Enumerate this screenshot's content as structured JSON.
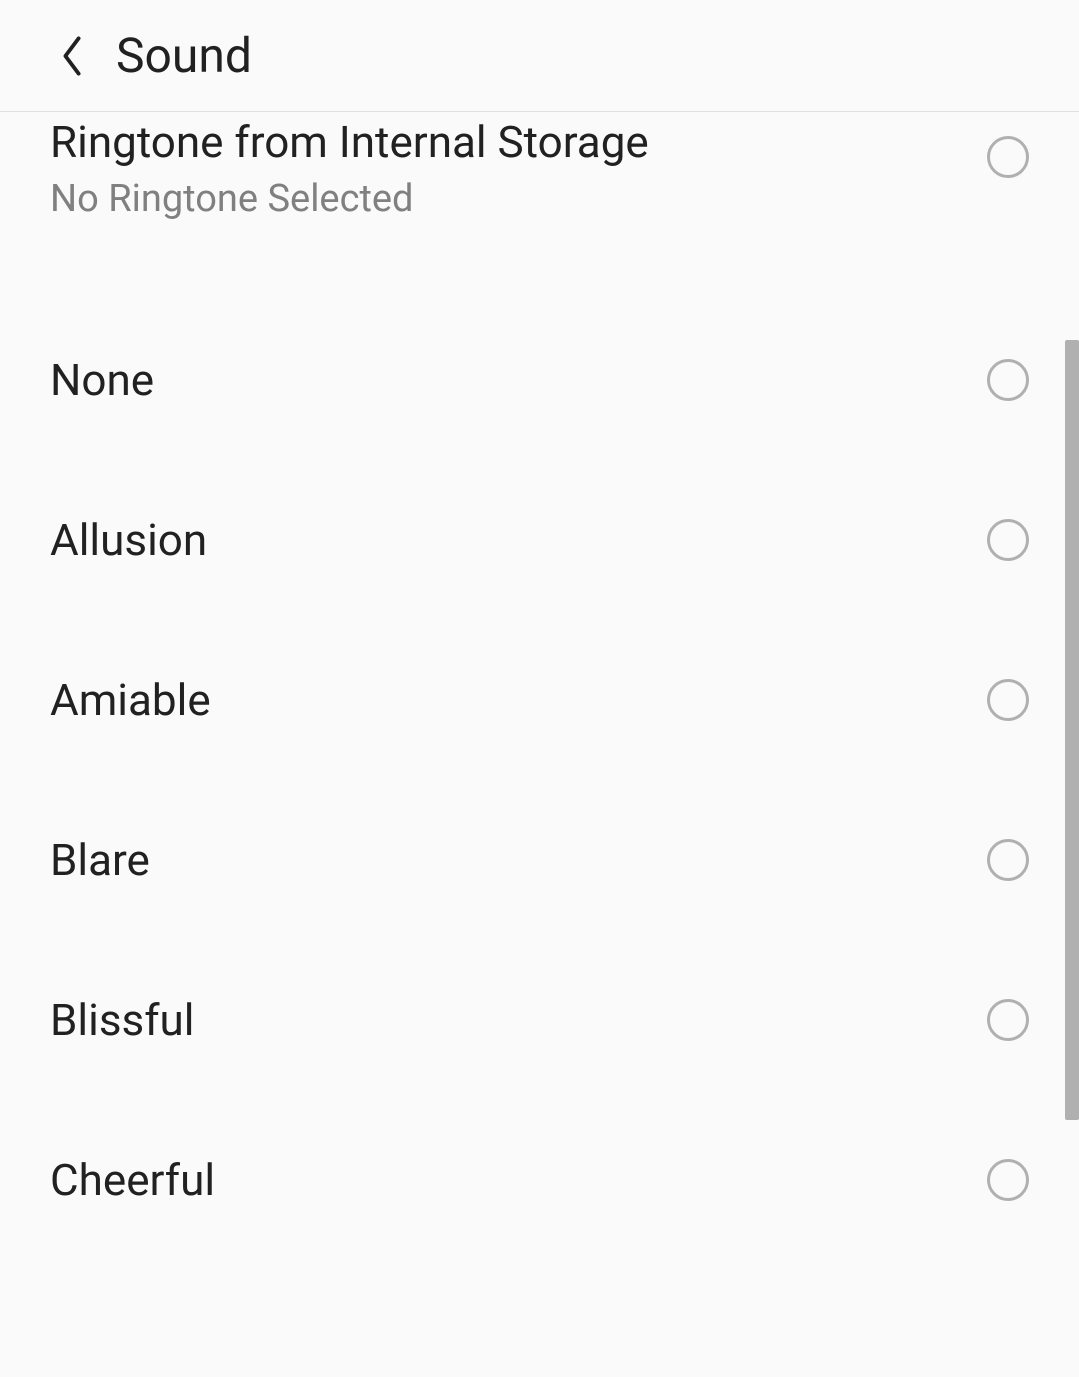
{
  "header": {
    "title": "Sound"
  },
  "storage_option": {
    "title": "Ringtone from Internal Storage",
    "subtitle": "No Ringtone Selected"
  },
  "options": [
    {
      "label": "None"
    },
    {
      "label": "Allusion"
    },
    {
      "label": "Amiable"
    },
    {
      "label": "Blare"
    },
    {
      "label": "Blissful"
    },
    {
      "label": "Cheerful"
    }
  ]
}
